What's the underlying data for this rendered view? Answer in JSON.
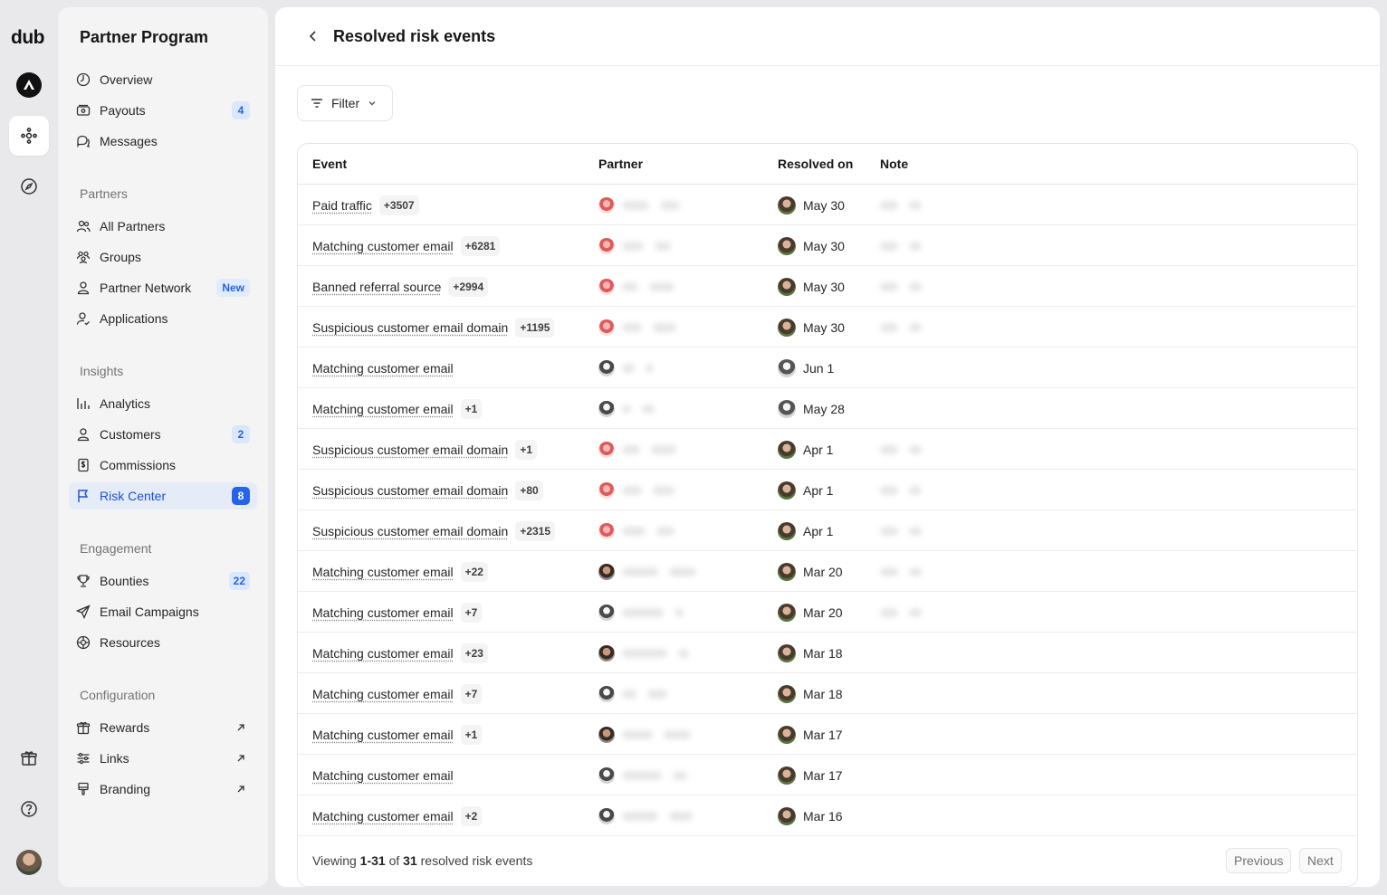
{
  "rail": {
    "logo": "dub"
  },
  "sidebar": {
    "title": "Partner Program",
    "top_items": [
      {
        "label": "Overview"
      },
      {
        "label": "Payouts",
        "badge": "4"
      },
      {
        "label": "Messages"
      }
    ],
    "sections": {
      "partners": "Partners",
      "insights": "Insights",
      "engagement": "Engagement",
      "configuration": "Configuration"
    },
    "partners_items": [
      {
        "label": "All Partners"
      },
      {
        "label": "Groups"
      },
      {
        "label": "Partner Network",
        "badge": "New"
      },
      {
        "label": "Applications"
      }
    ],
    "insights_items": [
      {
        "label": "Analytics"
      },
      {
        "label": "Customers",
        "badge": "2"
      },
      {
        "label": "Commissions"
      },
      {
        "label": "Risk Center",
        "badge": "8"
      }
    ],
    "engagement_items": [
      {
        "label": "Bounties",
        "badge": "22"
      },
      {
        "label": "Email Campaigns"
      },
      {
        "label": "Resources"
      }
    ],
    "configuration_items": [
      {
        "label": "Rewards"
      },
      {
        "label": "Links"
      },
      {
        "label": "Branding"
      }
    ]
  },
  "main": {
    "title": "Resolved risk events",
    "filter_label": "Filter",
    "columns": {
      "event": "Event",
      "partner": "Partner",
      "resolved_on": "Resolved on",
      "note": "Note"
    },
    "rows": [
      {
        "event": "Paid traffic",
        "count": "+3507",
        "avatar": "red",
        "resolver": "green",
        "date": "May 30",
        "note": true
      },
      {
        "event": "Matching customer email",
        "count": "+6281",
        "avatar": "red",
        "resolver": "green",
        "date": "May 30",
        "note": true
      },
      {
        "event": "Banned referral source",
        "count": "+2994",
        "avatar": "red",
        "resolver": "green",
        "date": "May 30",
        "note": true
      },
      {
        "event": "Suspicious customer email domain",
        "count": "+1195",
        "avatar": "red",
        "resolver": "green",
        "date": "May 30",
        "note": true
      },
      {
        "event": "Matching customer email",
        "count": "",
        "avatar": "gray",
        "resolver": "gray",
        "date": "Jun 1",
        "note": false
      },
      {
        "event": "Matching customer email",
        "count": "+1",
        "avatar": "gray",
        "resolver": "gray",
        "date": "May 28",
        "note": false
      },
      {
        "event": "Suspicious customer email domain",
        "count": "+1",
        "avatar": "red",
        "resolver": "green",
        "date": "Apr 1",
        "note": true
      },
      {
        "event": "Suspicious customer email domain",
        "count": "+80",
        "avatar": "red",
        "resolver": "green",
        "date": "Apr 1",
        "note": true
      },
      {
        "event": "Suspicious customer email domain",
        "count": "+2315",
        "avatar": "red",
        "resolver": "green",
        "date": "Apr 1",
        "note": true
      },
      {
        "event": "Matching customer email",
        "count": "+22",
        "avatar": "photo",
        "resolver": "green",
        "date": "Mar 20",
        "note": true
      },
      {
        "event": "Matching customer email",
        "count": "+7",
        "avatar": "gray",
        "resolver": "green",
        "date": "Mar 20",
        "note": true
      },
      {
        "event": "Matching customer email",
        "count": "+23",
        "avatar": "photo",
        "resolver": "green",
        "date": "Mar 18",
        "note": false
      },
      {
        "event": "Matching customer email",
        "count": "+7",
        "avatar": "gray",
        "resolver": "green",
        "date": "Mar 18",
        "note": false
      },
      {
        "event": "Matching customer email",
        "count": "+1",
        "avatar": "photo",
        "resolver": "green",
        "date": "Mar 17",
        "note": false
      },
      {
        "event": "Matching customer email",
        "count": "",
        "avatar": "gray",
        "resolver": "green",
        "date": "Mar 17",
        "note": false
      },
      {
        "event": "Matching customer email",
        "count": "+2",
        "avatar": "gray",
        "resolver": "green",
        "date": "Mar 16",
        "note": false
      }
    ],
    "footer": {
      "prefix": "Viewing ",
      "range": "1-31",
      "of": " of ",
      "total": "31",
      "suffix": " resolved risk events",
      "previous": "Previous",
      "next": "Next"
    }
  }
}
